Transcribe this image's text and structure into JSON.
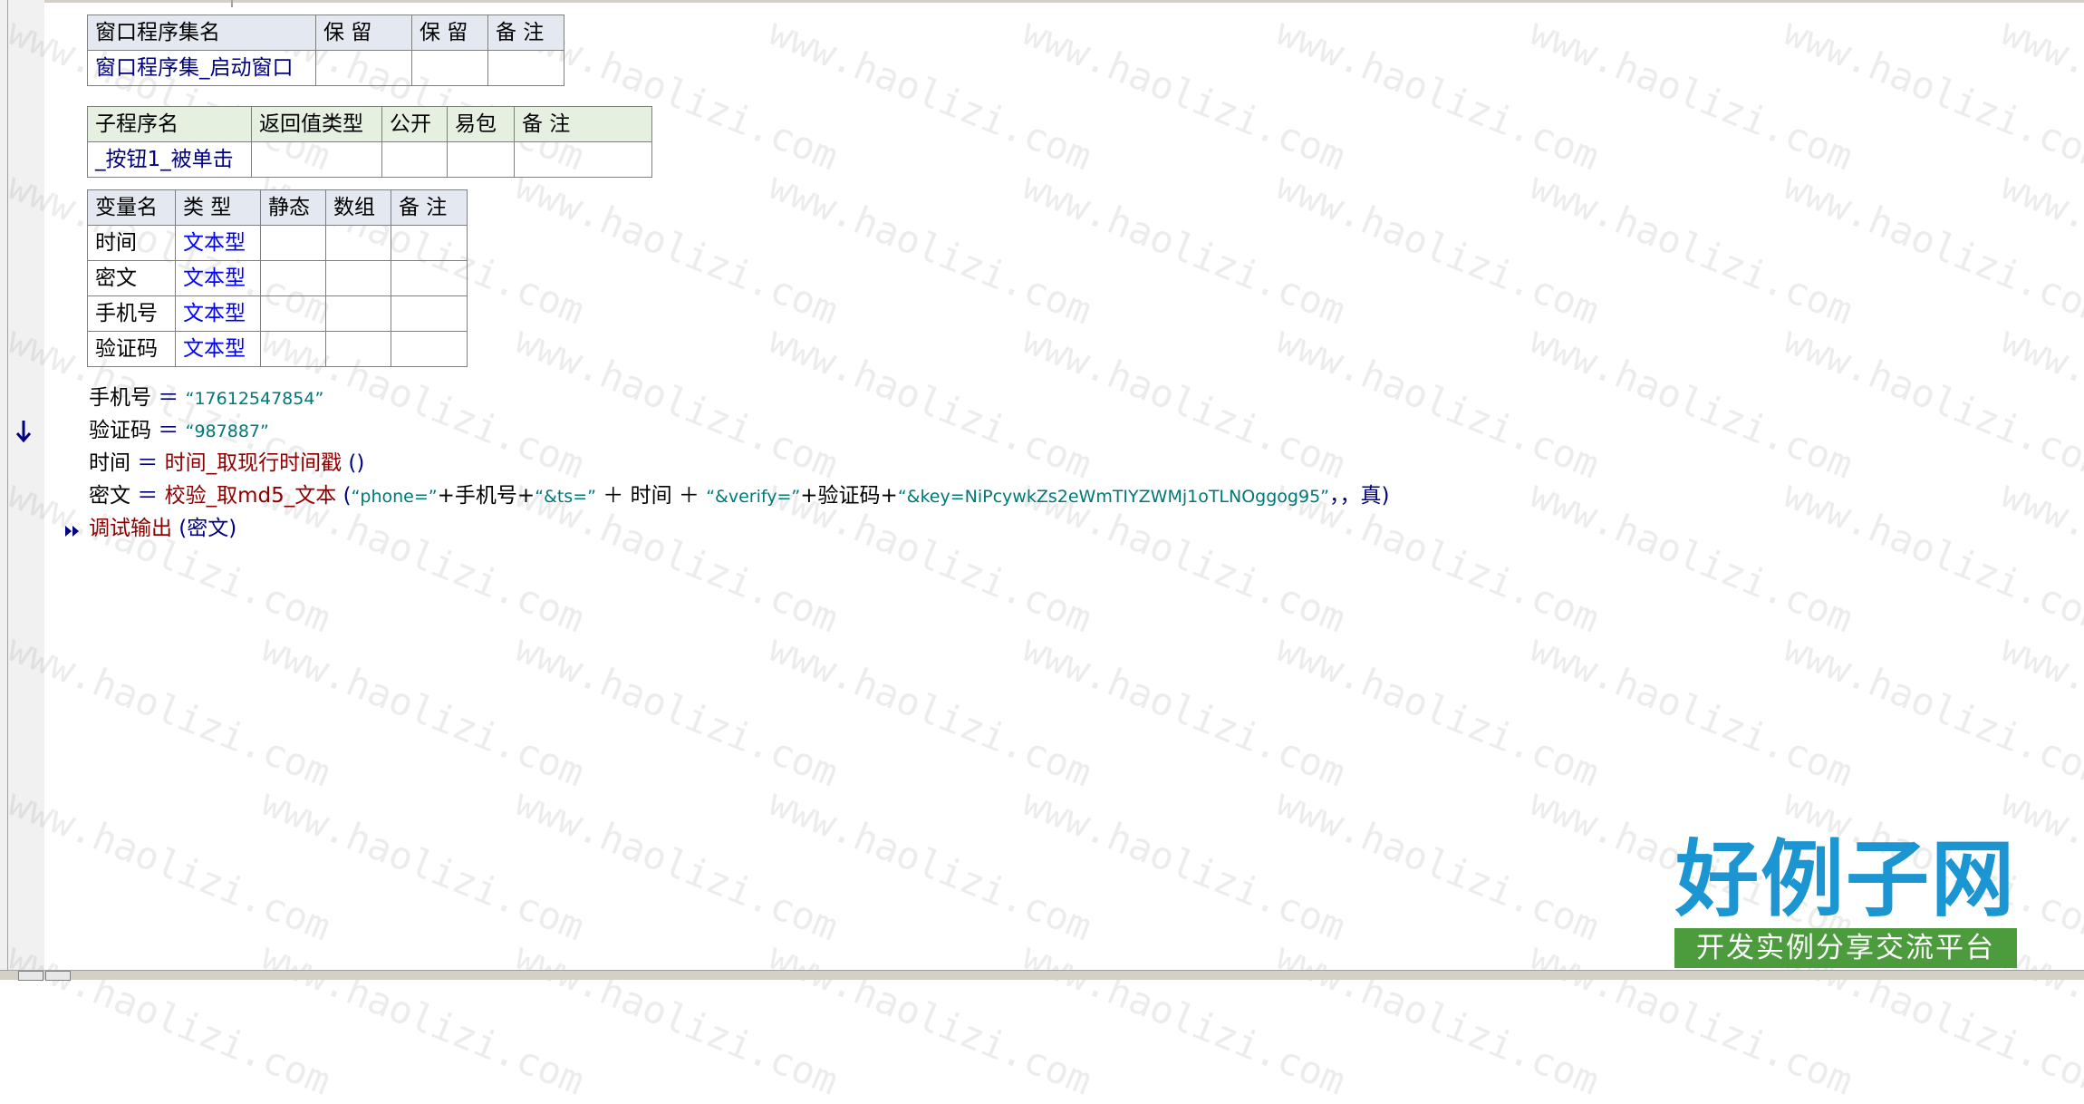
{
  "watermark_text": "www.haolizi.com",
  "logo": {
    "title": "好例子网",
    "tagline": "开发实例分享交流平台"
  },
  "window_table": {
    "headers": [
      "窗口程序集名",
      "保 留",
      "保 留",
      "备 注"
    ],
    "row": [
      "窗口程序集_启动窗口",
      "",
      "",
      ""
    ]
  },
  "sub_table": {
    "headers": [
      "子程序名",
      "返回值类型",
      "公开",
      "易包",
      "备 注"
    ],
    "row": [
      "_按钮1_被单击",
      "",
      "",
      "",
      ""
    ]
  },
  "var_table": {
    "headers": [
      "变量名",
      "类 型",
      "静态",
      "数组",
      "备 注"
    ],
    "rows": [
      {
        "name": "时间",
        "type": "文本型"
      },
      {
        "name": "密文",
        "type": "文本型"
      },
      {
        "name": "手机号",
        "type": "文本型"
      },
      {
        "name": "验证码",
        "type": "文本型"
      }
    ]
  },
  "code": {
    "l1": {
      "var": "手机号",
      "op": " ＝ ",
      "str": "“17612547854”"
    },
    "l2": {
      "var": "验证码",
      "op": " ＝ ",
      "str": "“987887”"
    },
    "l3": {
      "var": "时间",
      "op": " ＝ ",
      "fn": "时间_取现行时间戳",
      "args": " ()"
    },
    "l4": {
      "var": "密文",
      "op": " ＝ ",
      "fn": "校验_取md5_文本",
      "p1": " (",
      "s1": "“phone=”",
      "p2": "+手机号+",
      "s2": "“&ts=”",
      "p3": " ＋ 时间 ＋ ",
      "s3": "“&verify=”",
      "p4": "+验证码+",
      "s4": "“&key=NiPcywkZs2eWmTIYZWMj1oTLNOggog95”",
      "p5": "，，",
      "kw": "真",
      "p6": ")"
    },
    "l5": {
      "fn": "调试输出",
      "args": " (密文)"
    }
  }
}
